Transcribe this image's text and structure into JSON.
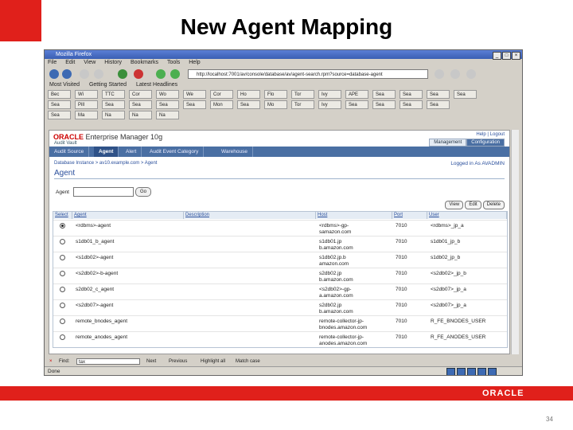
{
  "slide": {
    "title": "New Agent Mapping",
    "footer_logo": "ORACLE",
    "page_number": "34",
    "accent_color": "#e0201b"
  },
  "browser": {
    "window_title": "Mozilla Firefox",
    "menus": [
      "File",
      "Edit",
      "View",
      "History",
      "Bookmarks",
      "Tools",
      "Help"
    ],
    "url": "http://localhost:7001/av/console/database/av/agent-search.rpm?source=database-agent",
    "bookmarks": [
      "Most Visited",
      "Getting Started",
      "Latest Headlines"
    ],
    "tabs": [
      "Bec",
      "Wi",
      "TTC",
      "Cor",
      "Wo",
      "We",
      "Cor",
      "Ho",
      "Flo",
      "Tor",
      "Ivy",
      "APE",
      "Sea",
      "Sea",
      "Sea",
      "Sea",
      "Sea",
      "Pill",
      "Sea",
      "Sea",
      "Sea",
      "Sea",
      "Mon",
      "Sea",
      "Mo",
      "Tor",
      "Ivy",
      "Sea",
      "Sea",
      "Sea",
      "Sea",
      "Sea",
      "Ma",
      "Na",
      "Na",
      "Na"
    ],
    "find_label": "Find:",
    "find_value": "tax",
    "find_next": "Next",
    "find_previous": "Previous",
    "find_highlight": "Highlight all",
    "find_match_case": "Match case",
    "status": "Done"
  },
  "app": {
    "brand": "ORACLE",
    "product": "Enterprise Manager 10g",
    "subproduct": "Audit Vault",
    "links": {
      "help": "Help",
      "logout": "Logout"
    },
    "header_tabs": [
      "Management",
      "Configuration"
    ],
    "nav_tabs": [
      "Audit Source",
      "Agent",
      "Alert",
      "Audit Event Category",
      "Warehouse"
    ],
    "breadcrumb": [
      "Database Instance",
      "av10.example.com",
      "Agent"
    ],
    "logged_in": "Logged in As AVADMIN",
    "heading": "Agent",
    "search_label": "Agent",
    "go_label": "Go",
    "actions": [
      "View",
      "Edit",
      "Delete"
    ],
    "columns": [
      "Select",
      "Agent",
      "Description",
      "Host",
      "Port",
      "User"
    ],
    "rows": [
      {
        "selected": true,
        "agent": "<rdbms>-agent",
        "description": "",
        "host": "<rdbms>-gp-\nsamazon.com",
        "port": "7010",
        "user": "<rdbms>_jp_a"
      },
      {
        "selected": false,
        "agent": "s1db01_b_agent",
        "description": "",
        "host": "s1db01.jp\nb.amazon.com",
        "port": "7010",
        "user": "s1db01_jp_b"
      },
      {
        "selected": false,
        "agent": "<s1db02>-agent",
        "description": "",
        "host": "s1db02.jp.b\namazon.com",
        "port": "7010",
        "user": "s1db02_jp_b"
      },
      {
        "selected": false,
        "agent": "<s2db02>-b-agent",
        "description": "",
        "host": "s2db02.jp\nb.amazon.com",
        "port": "7010",
        "user": "<s2db02>_jp_b"
      },
      {
        "selected": false,
        "agent": "s2db02_c_agent",
        "description": "",
        "host": "<s2db02>-gp-\na.amazon.com",
        "port": "7010",
        "user": "<s2db07>_jp_a"
      },
      {
        "selected": false,
        "agent": "<s2db07>-agent",
        "description": "",
        "host": "s2db02.jp\nb.amazon.com",
        "port": "7010",
        "user": "<s2db07>_jp_a"
      },
      {
        "selected": false,
        "agent": "remote_bnodes_agent",
        "description": "",
        "host": "remote-collector-jp-\nbnodes.amazon.com",
        "port": "7010",
        "user": "R_FE_BNODES_USER"
      },
      {
        "selected": false,
        "agent": "remote_anodes_agent",
        "description": "",
        "host": "remote-collector-jp-\nanodes.amazon.com",
        "port": "7010",
        "user": "R_FE_ANODES_USER"
      }
    ]
  }
}
